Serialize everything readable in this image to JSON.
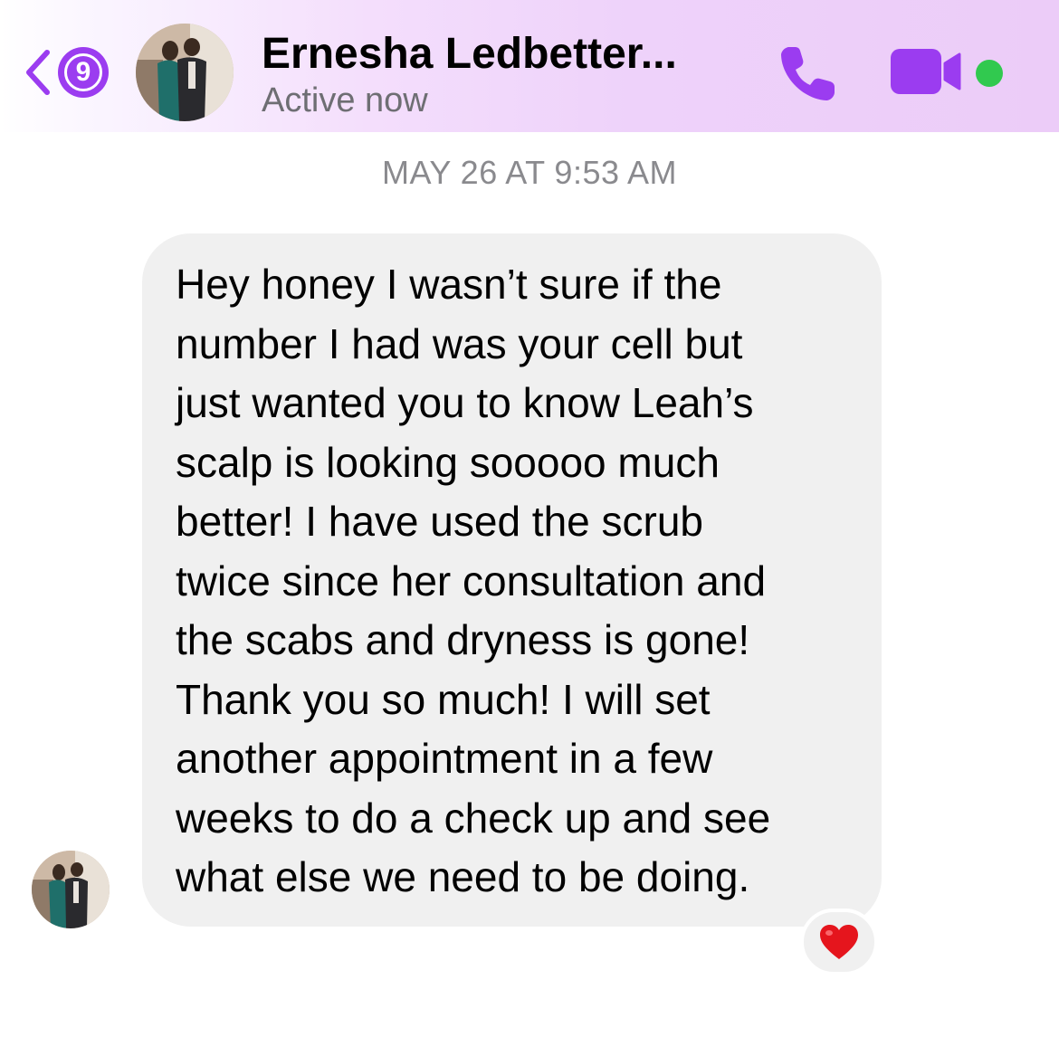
{
  "header": {
    "unread_count": "9",
    "contact_name": "Ernesha Ledbetter...",
    "status": "Active now"
  },
  "conversation": {
    "timestamp": "MAY 26 AT 9:53 AM",
    "messages": [
      {
        "text": "Hey honey I wasn’t sure if the\nnumber I had was your cell but\njust wanted you to know Leah’s\nscalp is looking sooooo much\nbetter! I have used the scrub\ntwice since her consultation and\nthe scabs and dryness is gone!\nThank you so much! I will set\nanother appointment in a few\nweeks to do a check up and see\nwhat else we need to be doing.",
        "reaction": "heart"
      }
    ]
  },
  "colors": {
    "accent": "#9B3CF0",
    "online": "#31c94f",
    "bubble": "#f0f0f0",
    "heart": "#e5151d"
  },
  "icons": {
    "back": "chevron-left-icon",
    "call": "phone-icon",
    "video": "video-camera-icon",
    "reaction": "red-heart-icon"
  }
}
